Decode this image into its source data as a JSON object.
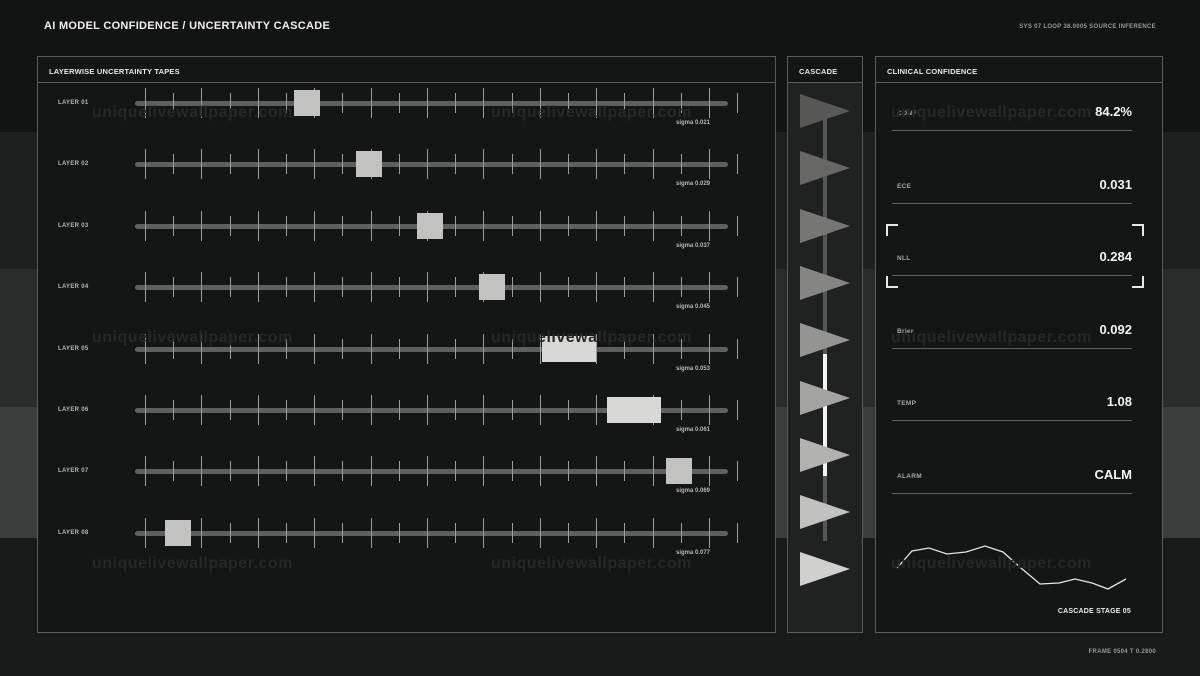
{
  "header": {
    "title": "AI MODEL CONFIDENCE / UNCERTAINTY CASCADE",
    "meta": "SYS 07  LOOP 38.0005  SOURCE INFERENCE"
  },
  "footer": {
    "meta": "FRAME 0504  T 0.2800"
  },
  "tapes": {
    "title": "LAYERWISE UNCERTAINTY TAPES",
    "layers": [
      {
        "label": "LAYER 01",
        "sigma": "sigma 0.021",
        "position": 0.29,
        "spread": "narrow"
      },
      {
        "label": "LAYER 02",
        "sigma": "sigma 0.029",
        "position": 0.394,
        "spread": "narrow"
      },
      {
        "label": "LAYER 03",
        "sigma": "sigma 0.037",
        "position": 0.498,
        "spread": "narrow"
      },
      {
        "label": "LAYER 04",
        "sigma": "sigma 0.045",
        "position": 0.602,
        "spread": "narrow"
      },
      {
        "label": "LAYER 05",
        "sigma": "sigma 0.053",
        "position": 0.732,
        "spread": "wide"
      },
      {
        "label": "LAYER 06",
        "sigma": "sigma 0.061",
        "position": 0.842,
        "spread": "wide"
      },
      {
        "label": "LAYER 07",
        "sigma": "sigma 0.069",
        "position": 0.917,
        "spread": "narrow"
      },
      {
        "label": "LAYER 08",
        "sigma": "sigma 0.077",
        "position": 0.072,
        "spread": "narrow"
      }
    ]
  },
  "cascade": {
    "title": "CASCADE",
    "stage_count": 9,
    "active_stage": 5
  },
  "confidence": {
    "title": "CLINICAL CONFIDENCE",
    "metrics": [
      {
        "label": "CONF",
        "value": "84.2%"
      },
      {
        "label": "ECE",
        "value": "0.031"
      },
      {
        "label": "NLL",
        "value": "0.284",
        "highlighted": true
      },
      {
        "label": "Brier",
        "value": "0.092"
      },
      {
        "label": "TEMP",
        "value": "1.08"
      },
      {
        "label": "ALARM",
        "value": "CALM"
      }
    ],
    "stage_label": "CASCADE STAGE 05"
  },
  "colors": {
    "background": "#0f1010",
    "panel": "#141515",
    "accent": "#f2f2f0",
    "marker": "#c2c3c1"
  },
  "watermark": "uniquelivewallpaper.com"
}
